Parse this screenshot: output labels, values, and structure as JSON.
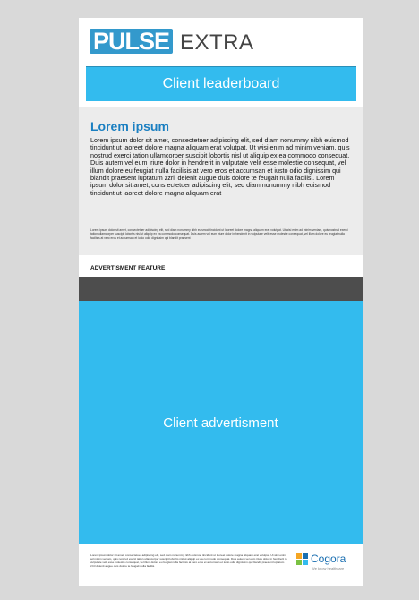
{
  "header": {
    "logo_primary": "PULSE",
    "logo_secondary": "EXTRA",
    "leaderboard_label": "Client leaderboard"
  },
  "article": {
    "title": "Lorem ipsum",
    "body": "Lorem ipsum dolor sit amet, consectetuer adipiscing elit, sed diam nonummy nibh euismod tincidunt ut laoreet dolore magna aliquam erat volutpat. Ut wisi enim ad minim veniam, quis nostrud exerci tation ullamcorper suscipit lobortis nisl ut aliquip ex ea commodo consequat. Duis autem vel eum iriure dolor in hendrerit in vulputate velit esse molestie consequat, vel illum dolore eu feugiat nulla facilisis at vero eros et accumsan et iusto odio dignissim qui blandit praesent luptatum zzril delenit augue duis dolore te feugait nulla facilisi. Lorem ipsum dolor sit amet, cons ectetuer adipiscing elit, sed diam nonummy nibh euismod tincidunt ut laoreet dolore magna aliquam erat",
    "fine_print": "Lorem ipsum dolor sit amet, consectetuer adipiscing elit, sed diam nonummy nibh euismod tincidunt ut laoreet dolore magna aliquam erat volutpat. Ut wisi enim ad minim veniam, quis nostrud exerci tation ullamcorper suscipit lobortis nisl ut aliquip ex ea commodo consequat. Duis autem vel eum iriure dolor in hendrerit in vulputate velit esse molestie consequat, vel illum dolore eu feugiat nulla facilisis at vero eros et accumsan et iusto odio dignissim qui blandit praesent"
  },
  "advert": {
    "feature_label": "ADVERTISMENT FEATURE",
    "main_label": "Client advertisment",
    "footer_text": "Lorem ipsum dolor sit amet, consectetuer adipiscing elit, sed diam nonummy nibh euismod tincidunt ut laoreet dolore magna aliquam erat volutpat. Ut wisi enim ad minim veniam, quis nostrud exerci tation ullamcorper suscipit lobortis nisl ut aliquip ex ea commodo consequat. Duis autem vel eum iriure dolor in hendrerit in vulputate velit esse molestie consequat, vel illum dolore eu feugiat nulla facilisis at vero eros et accumsan et iusto odio dignissim qui blandit praesent luptatum zzril delenit augue duis dolore te feugait nulla facilisi."
  },
  "brand": {
    "name": "Cogora",
    "tagline": "We know healthcare",
    "logo_icon": "cogora-grid-icon",
    "colors": {
      "sq1": "#f5a623",
      "sq2": "#1a6fb1",
      "sq3": "#7ac143",
      "sq4": "#33bbee"
    }
  },
  "colors": {
    "accent": "#33bbee",
    "title": "#1a7fc1",
    "dark_bar": "#4d4d4d"
  }
}
